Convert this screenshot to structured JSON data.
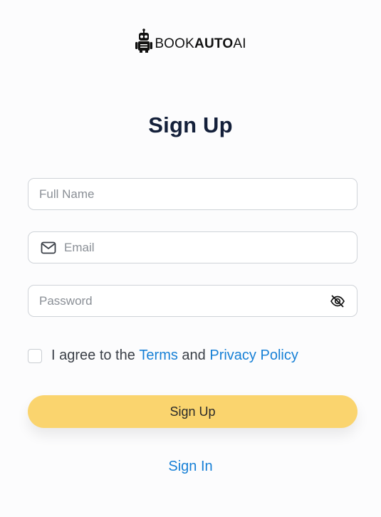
{
  "brand": {
    "logo_icon": "robot-icon",
    "name_part1": "BOOK",
    "name_part2": "AUTO",
    "name_part3": "AI"
  },
  "form": {
    "title": "Sign Up",
    "full_name": {
      "placeholder": "Full Name",
      "value": ""
    },
    "email": {
      "placeholder": "Email",
      "value": "",
      "icon": "mail-icon"
    },
    "password": {
      "placeholder": "Password",
      "value": "",
      "icon": "eye-off-icon"
    },
    "agree": {
      "checked": false,
      "prefix": "I agree to the ",
      "terms": "Terms",
      "middle": " and ",
      "privacy": "Privacy Policy"
    },
    "submit_label": "Sign Up",
    "signin_label": "Sign In"
  },
  "colors": {
    "accent": "#fad46e",
    "link": "#1780d6",
    "title": "#14203a"
  }
}
